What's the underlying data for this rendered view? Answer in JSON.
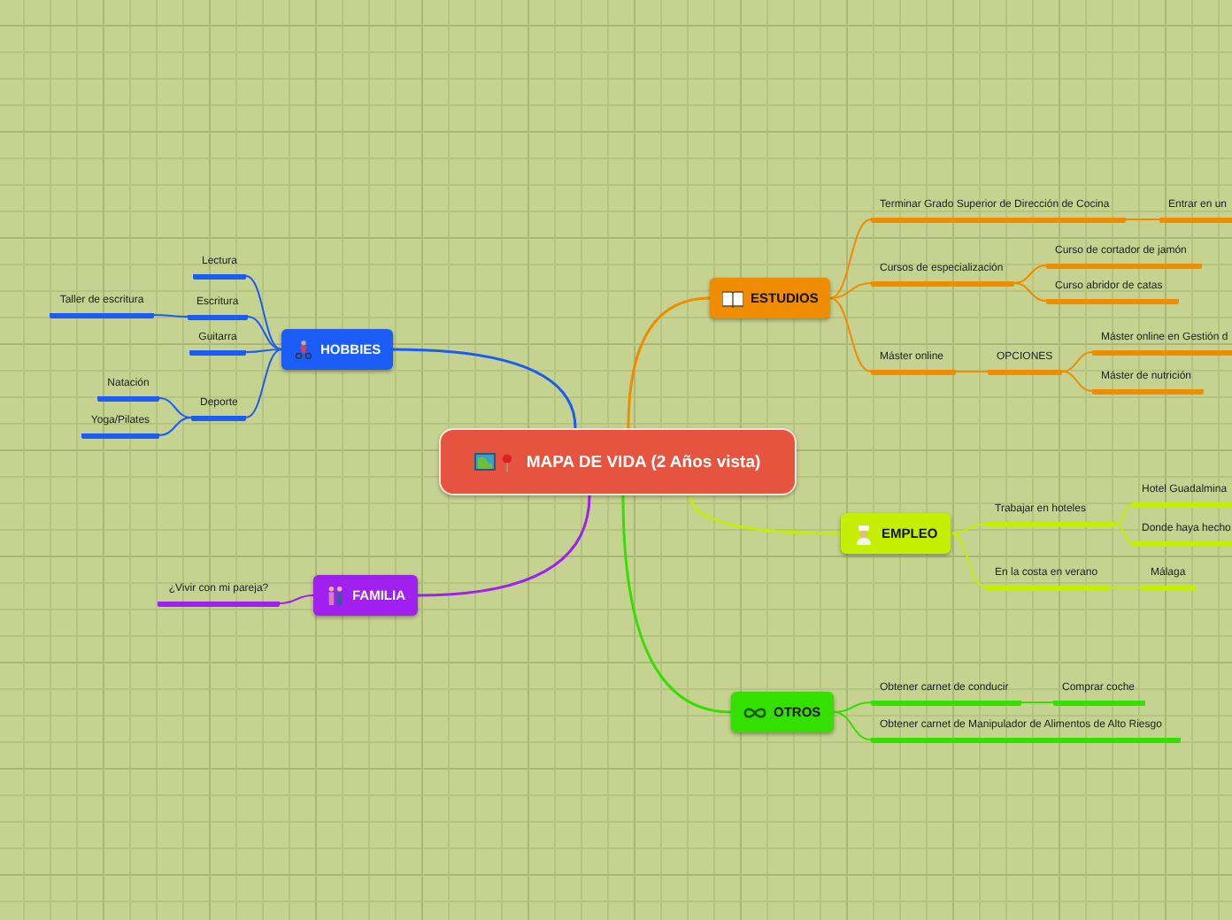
{
  "central": {
    "title": "MAPA DE VIDA (2 Años vista)"
  },
  "branches": [
    {
      "label": "ESTUDIOS",
      "kind": "book",
      "color": "#f08c00",
      "children": [
        {
          "label": "Terminar Grado Superior de Dirección de Cocina",
          "children": [
            {
              "label": "Entrar en un"
            }
          ]
        },
        {
          "label": "Cursos de especialización",
          "children": [
            {
              "label": "Curso de cortador de jamón"
            },
            {
              "label": "Curso abridor de catas"
            }
          ]
        },
        {
          "label": "Máster online",
          "children": [
            {
              "label": "OPCIONES",
              "children": [
                {
                  "label": "Máster online en Gestión d"
                },
                {
                  "label": "Máster de nutrición"
                }
              ]
            }
          ]
        }
      ]
    },
    {
      "label": "HOBBIES",
      "kind": "cyclist",
      "color": "#1a5cf5",
      "children": [
        {
          "label": "Lectura"
        },
        {
          "label": "Escritura",
          "children": [
            {
              "label": "Taller de escritura"
            }
          ]
        },
        {
          "label": "Guitarra"
        },
        {
          "label": "Deporte",
          "children": [
            {
              "label": "Natación"
            },
            {
              "label": "Yoga/Pilates"
            }
          ]
        }
      ]
    },
    {
      "label": "EMPLEO",
      "kind": "chef",
      "color": "#c6ee00",
      "children": [
        {
          "label": "Trabajar en hoteles",
          "children": [
            {
              "label": "Hotel Guadalmina"
            },
            {
              "label": "Donde haya hecho"
            }
          ]
        },
        {
          "label": "En la costa en verano",
          "children": [
            {
              "label": "Málaga"
            }
          ]
        }
      ]
    },
    {
      "label": "OTROS",
      "kind": "infinity",
      "color": "#33e000",
      "children": [
        {
          "label": "Obtener carnet de conducir",
          "children": [
            {
              "label": "Comprar coche"
            }
          ]
        },
        {
          "label": "Obtener carnet de Manipulador de Alimentos de Alto Riesgo"
        }
      ]
    },
    {
      "label": "FAMILIA",
      "kind": "couple",
      "color": "#a020f0",
      "children": [
        {
          "label": "¿Vivir con mi pareja?"
        }
      ]
    }
  ]
}
